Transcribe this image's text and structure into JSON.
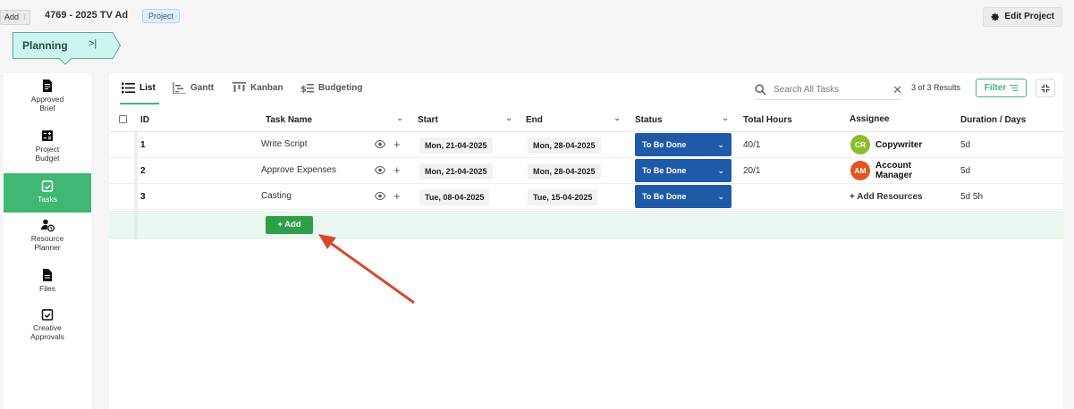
{
  "topbar": {
    "tooltip_label": "Add",
    "project_title": "4769 - 2025 TV Ad",
    "project_badge": "Project",
    "edit_project_label": "Edit Project"
  },
  "planning": {
    "label": "Planning",
    "collapse_icon": ">|"
  },
  "sidebar": {
    "items": [
      {
        "label_line1": "Approved",
        "label_line2": "Brief",
        "icon": "approved-brief-icon"
      },
      {
        "label_line1": "Project",
        "label_line2": "Budget",
        "icon": "budget-icon"
      },
      {
        "label_line1": "Tasks",
        "label_line2": "",
        "icon": "tasks-icon",
        "active": true
      },
      {
        "label_line1": "Resource",
        "label_line2": "Planner",
        "icon": "resource-planner-icon"
      },
      {
        "label_line1": "Files",
        "label_line2": "",
        "icon": "files-icon"
      },
      {
        "label_line1": "Creative",
        "label_line2": "Approvals",
        "icon": "creative-approvals-icon"
      }
    ]
  },
  "tabs": [
    {
      "label": "List",
      "active": true
    },
    {
      "label": "Gantt"
    },
    {
      "label": "Kanban"
    },
    {
      "label": "Budgeting"
    }
  ],
  "search": {
    "placeholder": "Search All Tasks",
    "value": ""
  },
  "results_text": "3 of 3 Results",
  "filter_label": "Filter",
  "table": {
    "headers": {
      "id": "ID",
      "task_name": "Task Name",
      "start": "Start",
      "end": "End",
      "status": "Status",
      "total_hours": "Total Hours",
      "assignee": "Assignee",
      "duration": "Duration / Days"
    },
    "rows": [
      {
        "id": "1",
        "name": "Write Script",
        "start": "Mon, 21-04-2025",
        "end": "Mon, 28-04-2025",
        "status": "To Be Done",
        "hours": "40/1",
        "assignee_initials": "CR",
        "assignee_line1": "Copywriter",
        "assignee_line2": "",
        "avatar_color": "#8bbd2a",
        "duration": "5d"
      },
      {
        "id": "2",
        "name": "Approve Expenses",
        "start": "Mon, 21-04-2025",
        "end": "Mon, 28-04-2025",
        "status": "To Be Done",
        "hours": "20/1",
        "assignee_initials": "AM",
        "assignee_line1": "Account",
        "assignee_line2": "Manager",
        "avatar_color": "#e1571f",
        "duration": "5d"
      },
      {
        "id": "3",
        "name": "Casting",
        "start": "Tue, 08-04-2025",
        "end": "Tue, 15-04-2025",
        "status": "To Be Done",
        "hours": "",
        "add_resources": "+ Add Resources",
        "duration": "5d 5h"
      }
    ],
    "add_button_label": "+ Add"
  },
  "colors": {
    "accent_green": "#40b873",
    "status_blue": "#1f5aa8",
    "add_button_green": "#2e9e47",
    "annotation_red": "#d9472f"
  }
}
